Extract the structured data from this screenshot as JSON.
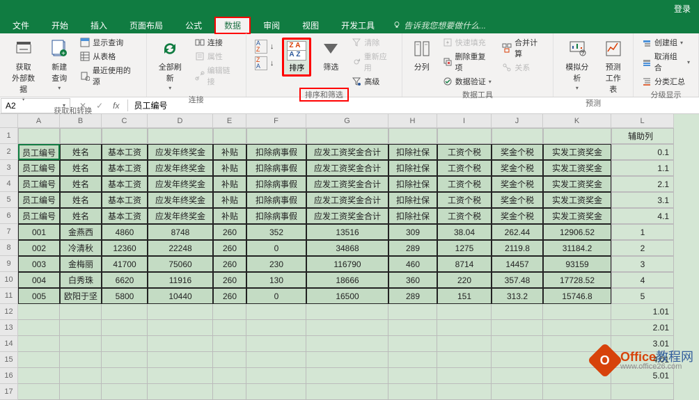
{
  "login": "登录",
  "tabs": [
    "文件",
    "开始",
    "插入",
    "页面布局",
    "公式",
    "数据",
    "审阅",
    "视图",
    "开发工具"
  ],
  "active_tab": "数据",
  "tell_me": "告诉我您想要做什么...",
  "ribbon": {
    "g1": {
      "label": "获取和转换",
      "btn1": "获取\n外部数据",
      "btn2": "新建\n查询",
      "i1": "显示查询",
      "i2": "从表格",
      "i3": "最近使用的源"
    },
    "g2": {
      "label": "连接",
      "btn": "全部刷新",
      "i1": "连接",
      "i2": "属性",
      "i3": "编辑链接"
    },
    "g3": {
      "label": "排序和筛选",
      "sort": "排序",
      "filter": "筛选",
      "i1": "清除",
      "i2": "重新应用",
      "i3": "高级"
    },
    "g4": {
      "label": "数据工具",
      "btn": "分列",
      "i1": "快速填充",
      "i2": "删除重复项",
      "i3": "数据验证",
      "i4": "合并计算",
      "i5": "关系"
    },
    "g5": {
      "label": "预测",
      "btn1": "模拟分析",
      "btn2": "预测\n工作表"
    },
    "g6": {
      "label": "分级显示",
      "i1": "创建组",
      "i2": "取消组合",
      "i3": "分类汇总"
    }
  },
  "namebox": "A2",
  "formula": "员工编号",
  "cols": [
    "A",
    "B",
    "C",
    "D",
    "E",
    "F",
    "G",
    "H",
    "I",
    "J",
    "K",
    "L"
  ],
  "aux_header": "辅助列",
  "headers": [
    "员工编号",
    "姓名",
    "基本工资",
    "应发年终奖金",
    "补贴",
    "扣除病事假",
    "应发工资奖金合计",
    "扣除社保",
    "工资个税",
    "奖金个税",
    "实发工资奖金"
  ],
  "header_repeat": 5,
  "aux_headers": [
    "0.1",
    "1.1",
    "2.1",
    "3.1",
    "4.1"
  ],
  "data": [
    [
      "001",
      "金燕西",
      "4860",
      "8748",
      "260",
      "352",
      "13516",
      "309",
      "38.04",
      "262.44",
      "12906.52",
      "1"
    ],
    [
      "002",
      "冷清秋",
      "12360",
      "22248",
      "260",
      "0",
      "34868",
      "289",
      "1275",
      "2119.8",
      "31184.2",
      "2"
    ],
    [
      "003",
      "金梅丽",
      "41700",
      "75060",
      "260",
      "230",
      "116790",
      "460",
      "8714",
      "14457",
      "93159",
      "3"
    ],
    [
      "004",
      "白秀珠",
      "6620",
      "11916",
      "260",
      "130",
      "18666",
      "360",
      "220",
      "357.48",
      "17728.52",
      "4"
    ],
    [
      "005",
      "欧阳于坚",
      "5800",
      "10440",
      "260",
      "0",
      "16500",
      "289",
      "151",
      "313.2",
      "15746.8",
      "5"
    ]
  ],
  "aux_tail": [
    "1.01",
    "2.01",
    "3.01",
    "4.01",
    "5.01"
  ],
  "watermark": {
    "title": "Office教程网",
    "url": "www.office26.com"
  }
}
